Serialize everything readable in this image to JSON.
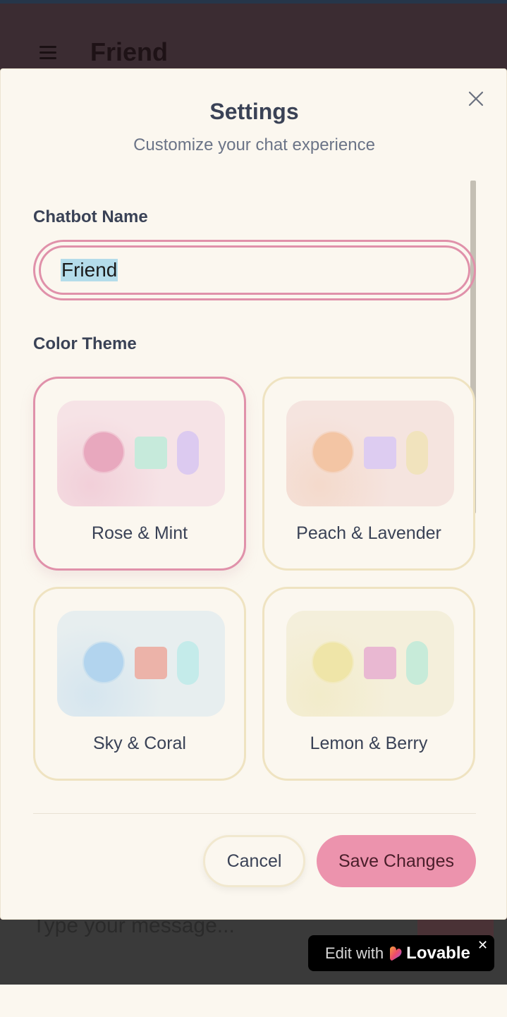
{
  "app": {
    "title": "Friend",
    "composer_placeholder": "Type your message..."
  },
  "modal": {
    "title": "Settings",
    "subtitle": "Customize your chat experience",
    "close_icon": "close-icon",
    "chatbot_name_label": "Chatbot Name",
    "chatbot_name_value": "Friend",
    "color_theme_label": "Color Theme",
    "themes": [
      {
        "label": "Rose & Mint",
        "selected": true,
        "colors": {
          "dot": "#e8a8be",
          "square": "#c6eadb",
          "pill": "#dccaf0",
          "bg": "#f6e3e6"
        }
      },
      {
        "label": "Peach & Lavender",
        "selected": false,
        "colors": {
          "dot": "#f3c5a4",
          "square": "#ddccf1",
          "pill": "#f1e3bd",
          "bg": "#f5e4df"
        }
      },
      {
        "label": "Sky & Coral",
        "selected": false,
        "colors": {
          "dot": "#b2d4ee",
          "square": "#ecb3a9",
          "pill": "#c4ebea",
          "bg": "#e7eeef"
        }
      },
      {
        "label": "Lemon & Berry",
        "selected": false,
        "colors": {
          "dot": "#efe5a8",
          "square": "#e9b8d2",
          "pill": "#c7ebd9",
          "bg": "#f4efdb"
        }
      }
    ],
    "cancel_label": "Cancel",
    "save_label": "Save Changes"
  },
  "badge": {
    "prefix": "Edit with",
    "brand": "Lovable",
    "close": "✕"
  },
  "colors": {
    "accent": "#e091aa",
    "save_button": "#ec93ad",
    "card_border": "#efe3c1",
    "modal_bg": "#fbf7ef"
  }
}
